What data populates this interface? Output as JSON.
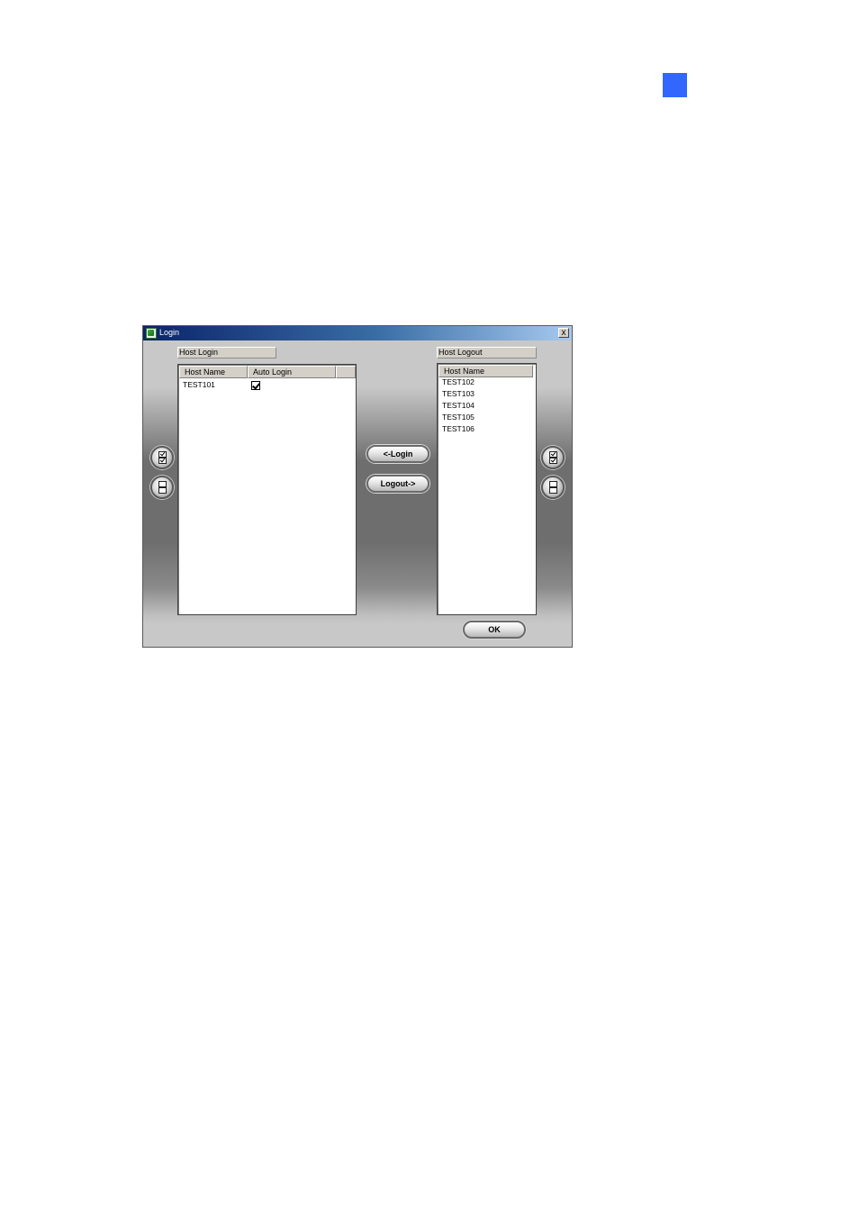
{
  "dialog": {
    "title": "Login",
    "close_label": "x"
  },
  "host_login": {
    "group_label": "Host Login",
    "columns": [
      "Host Name",
      "Auto Login"
    ],
    "rows": [
      {
        "host_name": "TEST101",
        "auto_login": true
      }
    ]
  },
  "host_logout": {
    "group_label": "Host Logout",
    "columns": [
      "Host Name"
    ],
    "rows": [
      "TEST102",
      "TEST103",
      "TEST104",
      "TEST105",
      "TEST106"
    ]
  },
  "buttons": {
    "login": "<-Login",
    "logout": "Logout->",
    "ok": "OK"
  },
  "side_buttons": {
    "left_select_all_icon": "select-all-icon",
    "left_clear_all_icon": "clear-all-icon",
    "right_select_all_icon": "select-all-icon",
    "right_clear_all_icon": "clear-all-icon"
  },
  "colors": {
    "page_marker": "#3366ff",
    "titlebar_start": "#0a246a",
    "titlebar_end": "#a6caf0"
  }
}
